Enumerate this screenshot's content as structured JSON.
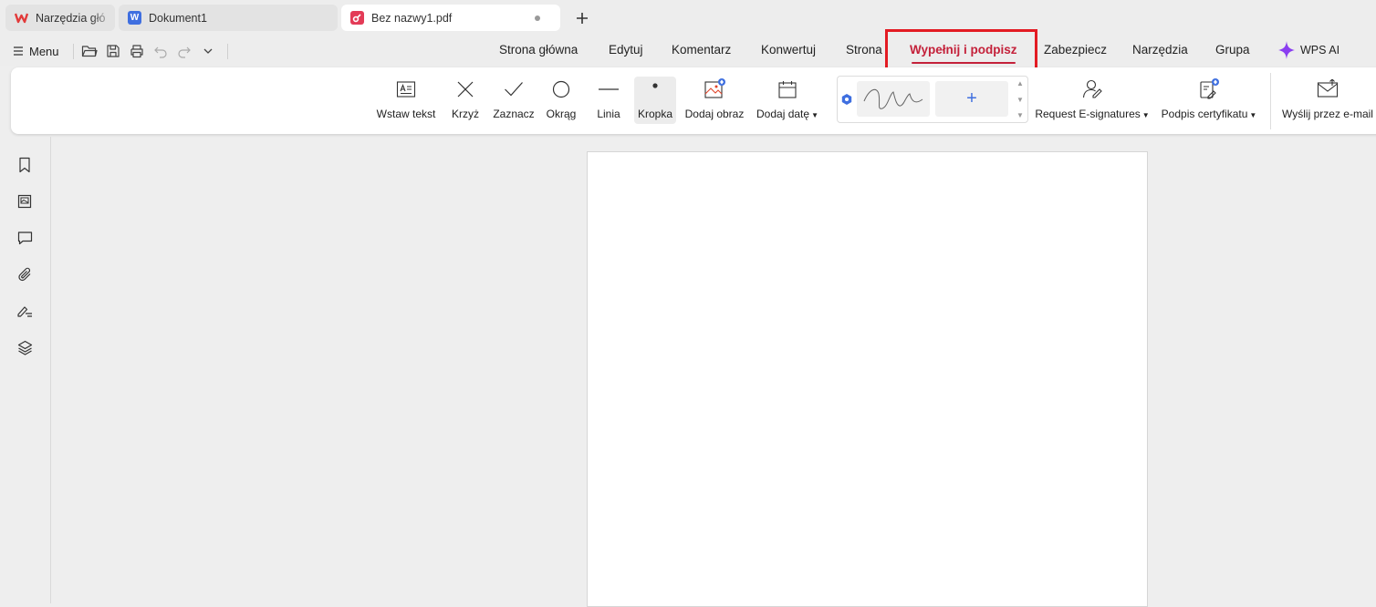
{
  "tabs": [
    {
      "label": "Narzędzia głó",
      "icon": "wps-logo-icon",
      "color": "#e23a3a"
    },
    {
      "label": "Dokument1",
      "icon": "writer-doc-icon",
      "color": "#3f6fe0"
    },
    {
      "label": "Bez nazwy1.pdf",
      "icon": "pdf-doc-icon",
      "color": "#e33b57",
      "active": true
    }
  ],
  "menu": {
    "label": "Menu"
  },
  "ribbon_tabs": [
    {
      "label": "Strona główna"
    },
    {
      "label": "Edytuj"
    },
    {
      "label": "Komentarz"
    },
    {
      "label": "Konwertuj"
    },
    {
      "label": "Strona"
    },
    {
      "label": "Wypełnij i podpisz",
      "active": true
    },
    {
      "label": "Zabezpiecz"
    },
    {
      "label": "Narzędzia"
    },
    {
      "label": "Grupa"
    }
  ],
  "wps_ai": {
    "label": "WPS AI"
  },
  "tools": {
    "insert_text": "Wstaw tekst",
    "cross": "Krzyż",
    "check": "Zaznacz",
    "circle": "Okrąg",
    "line": "Linia",
    "dot": "Kropka",
    "add_image": "Dodaj obraz",
    "add_date": "Dodaj datę",
    "request_esign": "Request E-signatures",
    "cert_sign": "Podpis certyfikatu",
    "send_email": "Wyślij przez e-mail"
  },
  "signature": {
    "add_symbol": "+"
  },
  "colors": {
    "accent": "#c4213a",
    "highlight_box": "#e31b23",
    "premium_badge": "#3f6fe0"
  }
}
